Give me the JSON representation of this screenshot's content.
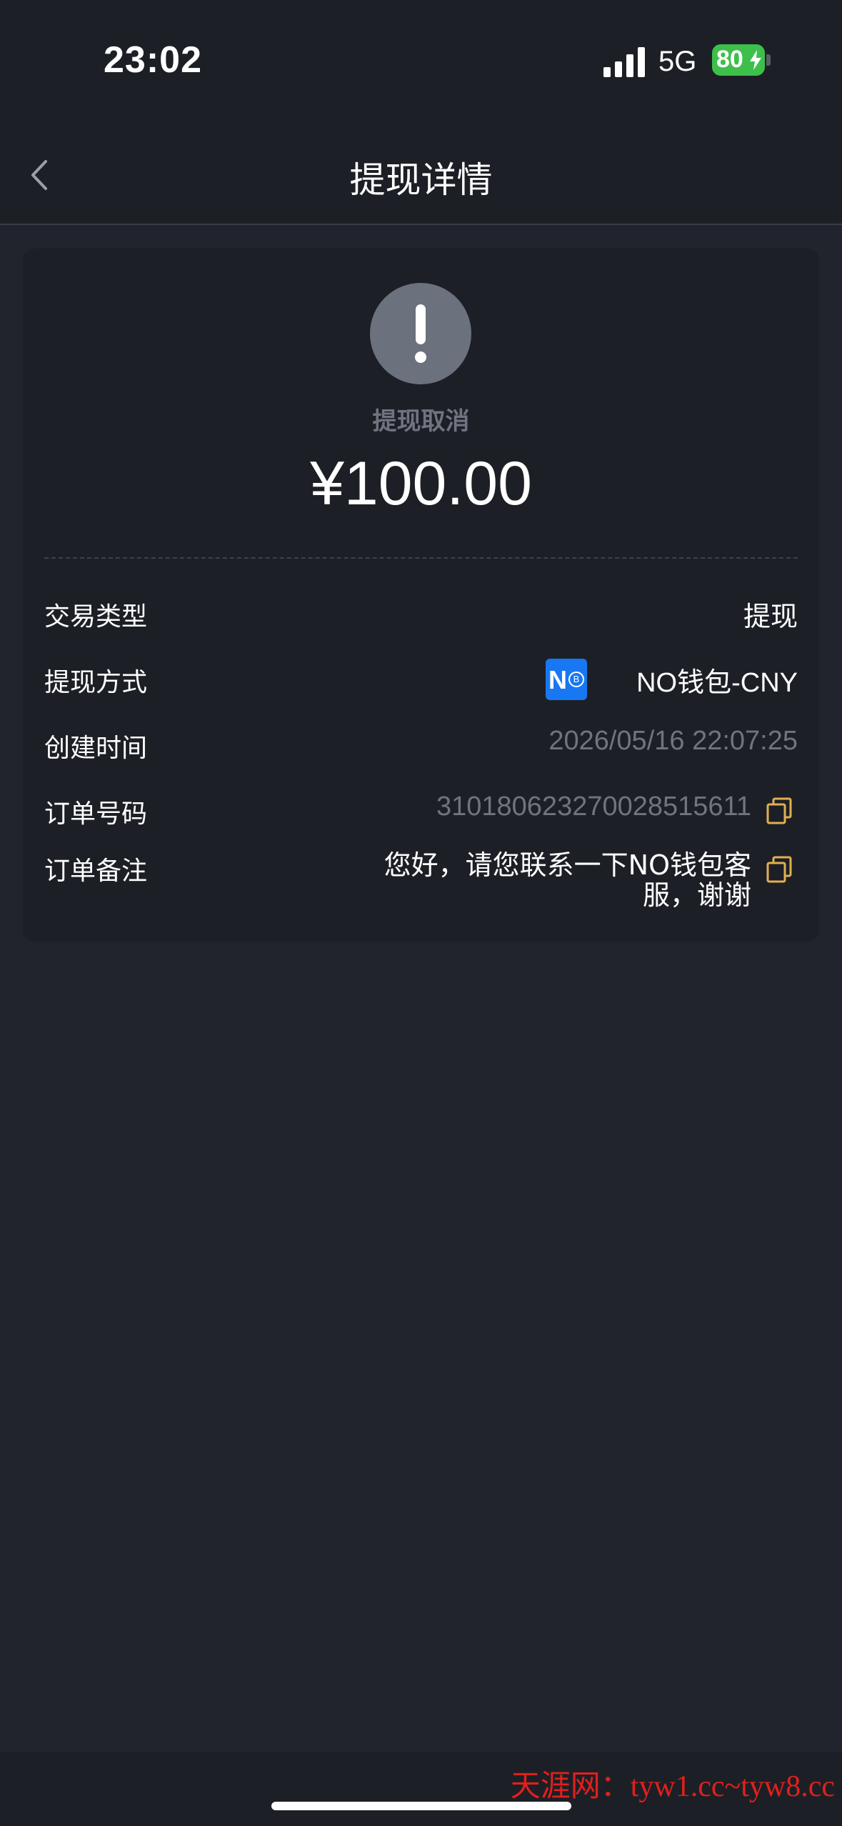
{
  "status_bar": {
    "time": "23:02",
    "network": "5G",
    "battery": "80"
  },
  "header": {
    "title": "提现详情",
    "back_icon": "chevron-left-icon"
  },
  "summary": {
    "status_icon": "exclamation-icon",
    "status_text": "提现取消",
    "amount": "¥100.00"
  },
  "details": {
    "type_label": "交易类型",
    "type_value": "提现",
    "method_label": "提现方式",
    "method_badge": "N",
    "method_badge_coin": "B",
    "method_value": "NO钱包-CNY",
    "created_label": "创建时间",
    "created_value": "2026/05/16 22:07:25",
    "order_label": "订单号码",
    "order_value": "3101806232700285156​11",
    "remark_label": "订单备注",
    "remark_value": "您好，请您联系一下NO钱包客服，谢谢"
  },
  "watermark": "天涯网：tyw1.cc~tyw8.cc",
  "colors": {
    "background": "#21232d",
    "card": "#1d1f26",
    "muted_text": "#6f7480",
    "copy_accent": "#e0b050",
    "badge_blue": "#1877f2"
  }
}
